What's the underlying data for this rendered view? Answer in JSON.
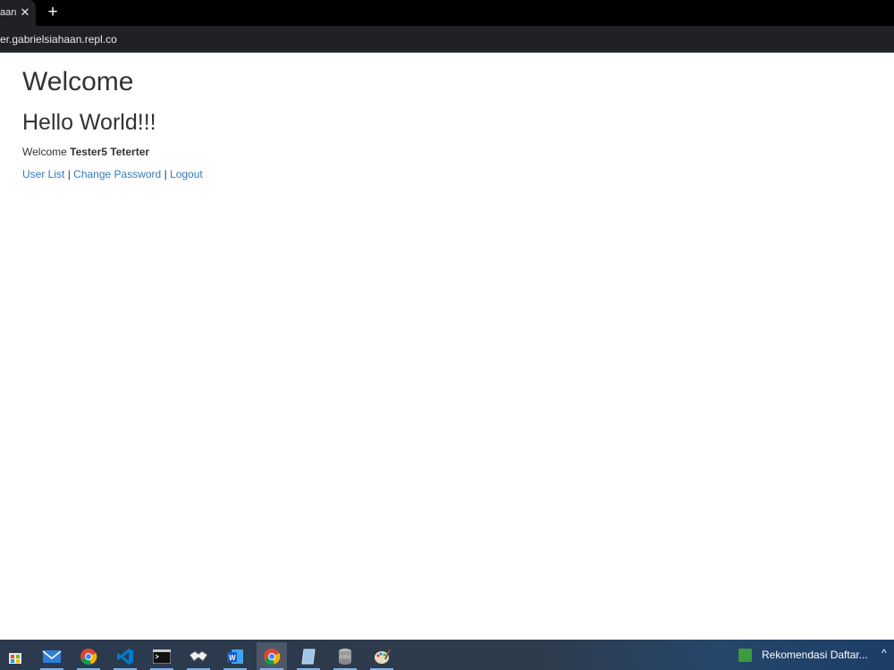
{
  "browser": {
    "tab_title": "aan",
    "tab_close": "✕",
    "new_tab": "+",
    "url": "er.gabrielsiahaan.repl.co"
  },
  "page": {
    "title": "Welcome",
    "heading": "Hello World!!!",
    "welcome_prefix": "Welcome",
    "user_name": "Tester5 Teterter",
    "links": {
      "user_list": "User List",
      "change_password": "Change Password",
      "logout": "Logout",
      "separator": "|"
    }
  },
  "taskbar": {
    "icons": [
      "windows-store-icon",
      "mail-icon",
      "chrome-icon",
      "vscode-icon",
      "terminal-icon",
      "handshake-icon",
      "word-icon",
      "chrome-active-icon",
      "notepad-icon",
      "database-icon",
      "paint-icon"
    ],
    "notification_label": "Rekomendasi Daftar...",
    "tray_chevron": "^"
  },
  "colors": {
    "link": "#337ab7",
    "text": "#333333",
    "browser_bg": "#202124"
  }
}
